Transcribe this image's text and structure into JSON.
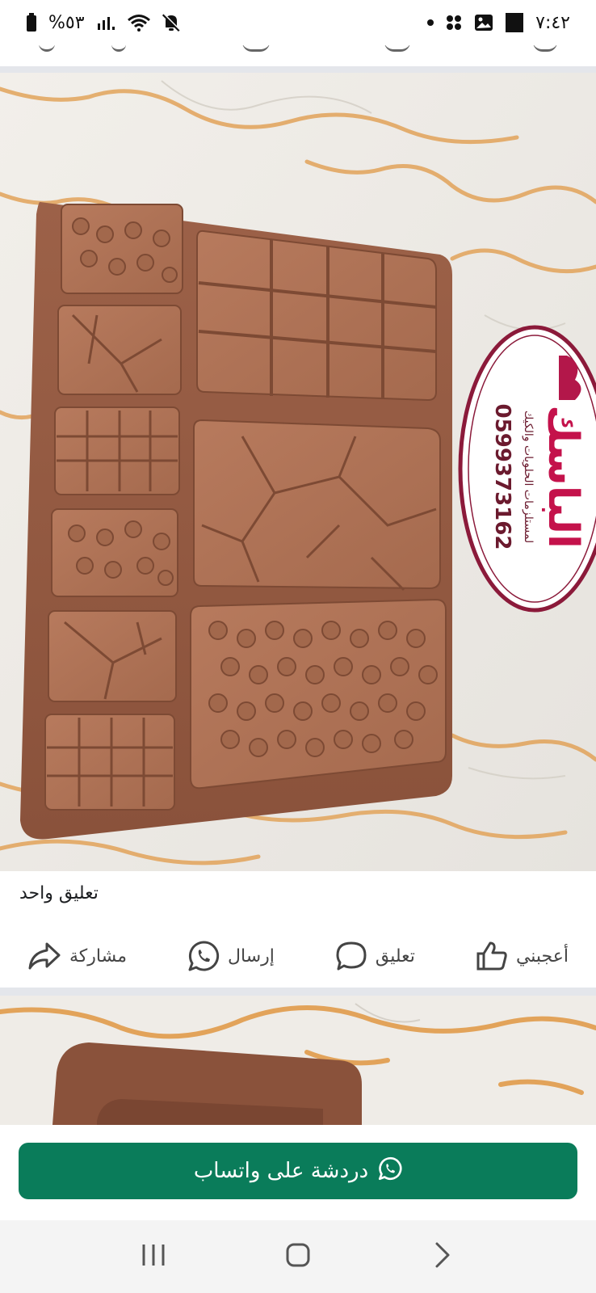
{
  "status_bar": {
    "battery": "%٥٣",
    "time": "٧:٤٢",
    "icons": [
      "battery-icon",
      "signal-icon",
      "wifi-icon",
      "mute-icon",
      "notification-dot-icon",
      "app-grid-icon",
      "image-icon",
      "square-notification-icon"
    ]
  },
  "post": {
    "image_alt": "قالب شوكولاتة سيليكون",
    "watermark": {
      "brand": "الباسك",
      "subtitle": "لمستلزمات الحلويات والكيك",
      "phone": "0599373162"
    },
    "comments_count": "تعليق واحد",
    "actions": [
      {
        "name": "like-button",
        "icon": "thumbs-up-icon",
        "label": "أعجبني"
      },
      {
        "name": "comment-button",
        "icon": "comment-bubble-icon",
        "label": "تعليق"
      },
      {
        "name": "send-button",
        "icon": "whatsapp-icon",
        "label": "إرسال"
      },
      {
        "name": "share-button",
        "icon": "share-arrow-icon",
        "label": "مشاركة"
      }
    ]
  },
  "whatsapp_cta": {
    "label": "دردشة على واتساب",
    "color": "#0a7c5a"
  },
  "nav": {
    "buttons": [
      "recent-apps-icon",
      "home-icon",
      "back-icon"
    ]
  }
}
